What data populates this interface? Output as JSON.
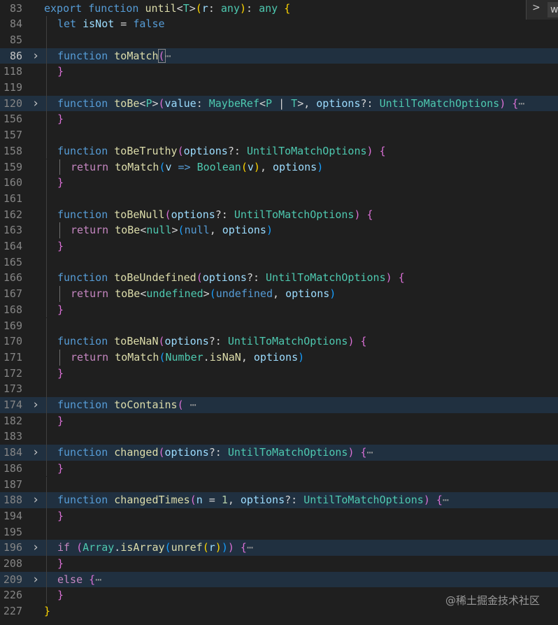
{
  "editor": {
    "lines": [
      {
        "n": "83",
        "tokens": [
          [
            "kw",
            "export "
          ],
          [
            "kw",
            "function "
          ],
          [
            "fn",
            "until"
          ],
          [
            "pl",
            "<"
          ],
          [
            "type",
            "T"
          ],
          [
            "pl",
            ">"
          ],
          [
            "br1",
            "("
          ],
          [
            "var",
            "r"
          ],
          [
            "pl",
            ": "
          ],
          [
            "type",
            "any"
          ],
          [
            "br1",
            ")"
          ],
          [
            "pl",
            ": "
          ],
          [
            "type",
            "any"
          ],
          [
            "pl",
            " "
          ],
          [
            "br1",
            "{"
          ]
        ]
      },
      {
        "n": "84",
        "tokens": [
          [
            "kw",
            "let "
          ],
          [
            "var",
            "isNot"
          ],
          [
            "pl",
            " = "
          ],
          [
            "kw",
            "false"
          ]
        ]
      },
      {
        "n": "85",
        "tokens": []
      },
      {
        "n": "86",
        "active": true,
        "fold": true,
        "tokens": [
          [
            "kw",
            "function "
          ],
          [
            "fn",
            "toMatch"
          ],
          [
            "br2",
            "("
          ],
          [
            "dim",
            "⋯"
          ]
        ]
      },
      {
        "n": "118",
        "tokens": [
          [
            "br2",
            "}"
          ]
        ]
      },
      {
        "n": "119",
        "tokens": []
      },
      {
        "n": "120",
        "fold": true,
        "tokens": [
          [
            "kw",
            "function "
          ],
          [
            "fn",
            "toBe"
          ],
          [
            "pl",
            "<"
          ],
          [
            "type",
            "P"
          ],
          [
            "pl",
            ">"
          ],
          [
            "br2",
            "("
          ],
          [
            "var",
            "value"
          ],
          [
            "pl",
            ": "
          ],
          [
            "type",
            "MaybeRef"
          ],
          [
            "pl",
            "<"
          ],
          [
            "type",
            "P"
          ],
          [
            "pl",
            " | "
          ],
          [
            "type",
            "T"
          ],
          [
            "pl",
            ">"
          ],
          [
            "pl",
            ", "
          ],
          [
            "var",
            "options"
          ],
          [
            "pl",
            "?: "
          ],
          [
            "type",
            "UntilToMatchOptions"
          ],
          [
            "br2",
            ")"
          ],
          [
            "pl",
            " "
          ],
          [
            "br2",
            "{"
          ],
          [
            "dim",
            "⋯"
          ]
        ]
      },
      {
        "n": "156",
        "tokens": [
          [
            "br2",
            "}"
          ]
        ]
      },
      {
        "n": "157",
        "tokens": []
      },
      {
        "n": "158",
        "tokens": [
          [
            "kw",
            "function "
          ],
          [
            "fn",
            "toBeTruthy"
          ],
          [
            "br2",
            "("
          ],
          [
            "var",
            "options"
          ],
          [
            "pl",
            "?: "
          ],
          [
            "type",
            "UntilToMatchOptions"
          ],
          [
            "br2",
            ")"
          ],
          [
            "pl",
            " "
          ],
          [
            "br2",
            "{"
          ]
        ]
      },
      {
        "n": "159",
        "tokens": [
          [
            "ctl",
            "return "
          ],
          [
            "fn",
            "toMatch"
          ],
          [
            "br3",
            "("
          ],
          [
            "var",
            "v"
          ],
          [
            "pl",
            " "
          ],
          [
            "kw",
            "=>"
          ],
          [
            "pl",
            " "
          ],
          [
            "type",
            "Boolean"
          ],
          [
            "br1",
            "("
          ],
          [
            "var",
            "v"
          ],
          [
            "br1",
            ")"
          ],
          [
            "pl",
            ", "
          ],
          [
            "var",
            "options"
          ],
          [
            "br3",
            ")"
          ]
        ]
      },
      {
        "n": "160",
        "tokens": [
          [
            "br2",
            "}"
          ]
        ]
      },
      {
        "n": "161",
        "tokens": []
      },
      {
        "n": "162",
        "tokens": [
          [
            "kw",
            "function "
          ],
          [
            "fn",
            "toBeNull"
          ],
          [
            "br2",
            "("
          ],
          [
            "var",
            "options"
          ],
          [
            "pl",
            "?: "
          ],
          [
            "type",
            "UntilToMatchOptions"
          ],
          [
            "br2",
            ")"
          ],
          [
            "pl",
            " "
          ],
          [
            "br2",
            "{"
          ]
        ]
      },
      {
        "n": "163",
        "tokens": [
          [
            "ctl",
            "return "
          ],
          [
            "fn",
            "toBe"
          ],
          [
            "pl",
            "<"
          ],
          [
            "type",
            "null"
          ],
          [
            "pl",
            ">"
          ],
          [
            "br3",
            "("
          ],
          [
            "kw",
            "null"
          ],
          [
            "pl",
            ", "
          ],
          [
            "var",
            "options"
          ],
          [
            "br3",
            ")"
          ]
        ]
      },
      {
        "n": "164",
        "tokens": [
          [
            "br2",
            "}"
          ]
        ]
      },
      {
        "n": "165",
        "tokens": []
      },
      {
        "n": "166",
        "tokens": [
          [
            "kw",
            "function "
          ],
          [
            "fn",
            "toBeUndefined"
          ],
          [
            "br2",
            "("
          ],
          [
            "var",
            "options"
          ],
          [
            "pl",
            "?: "
          ],
          [
            "type",
            "UntilToMatchOptions"
          ],
          [
            "br2",
            ")"
          ],
          [
            "pl",
            " "
          ],
          [
            "br2",
            "{"
          ]
        ]
      },
      {
        "n": "167",
        "tokens": [
          [
            "ctl",
            "return "
          ],
          [
            "fn",
            "toBe"
          ],
          [
            "pl",
            "<"
          ],
          [
            "type",
            "undefined"
          ],
          [
            "pl",
            ">"
          ],
          [
            "br3",
            "("
          ],
          [
            "kw",
            "undefined"
          ],
          [
            "pl",
            ", "
          ],
          [
            "var",
            "options"
          ],
          [
            "br3",
            ")"
          ]
        ]
      },
      {
        "n": "168",
        "tokens": [
          [
            "br2",
            "}"
          ]
        ]
      },
      {
        "n": "169",
        "tokens": []
      },
      {
        "n": "170",
        "tokens": [
          [
            "kw",
            "function "
          ],
          [
            "fn",
            "toBeNaN"
          ],
          [
            "br2",
            "("
          ],
          [
            "var",
            "options"
          ],
          [
            "pl",
            "?: "
          ],
          [
            "type",
            "UntilToMatchOptions"
          ],
          [
            "br2",
            ")"
          ],
          [
            "pl",
            " "
          ],
          [
            "br2",
            "{"
          ]
        ]
      },
      {
        "n": "171",
        "tokens": [
          [
            "ctl",
            "return "
          ],
          [
            "fn",
            "toMatch"
          ],
          [
            "br3",
            "("
          ],
          [
            "type",
            "Number"
          ],
          [
            "pl",
            "."
          ],
          [
            "fn",
            "isNaN"
          ],
          [
            "pl",
            ", "
          ],
          [
            "var",
            "options"
          ],
          [
            "br3",
            ")"
          ]
        ]
      },
      {
        "n": "172",
        "tokens": [
          [
            "br2",
            "}"
          ]
        ]
      },
      {
        "n": "173",
        "tokens": []
      },
      {
        "n": "174",
        "fold": true,
        "tokens": [
          [
            "kw",
            "function "
          ],
          [
            "fn",
            "toContains"
          ],
          [
            "br2",
            "("
          ],
          [
            "pl",
            " "
          ],
          [
            "dim",
            "⋯"
          ]
        ]
      },
      {
        "n": "182",
        "tokens": [
          [
            "br2",
            "}"
          ]
        ]
      },
      {
        "n": "183",
        "tokens": []
      },
      {
        "n": "184",
        "fold": true,
        "tokens": [
          [
            "kw",
            "function "
          ],
          [
            "fn",
            "changed"
          ],
          [
            "br2",
            "("
          ],
          [
            "var",
            "options"
          ],
          [
            "pl",
            "?: "
          ],
          [
            "type",
            "UntilToMatchOptions"
          ],
          [
            "br2",
            ")"
          ],
          [
            "pl",
            " "
          ],
          [
            "br2",
            "{"
          ],
          [
            "dim",
            "⋯"
          ]
        ]
      },
      {
        "n": "186",
        "tokens": [
          [
            "br2",
            "}"
          ]
        ]
      },
      {
        "n": "187",
        "tokens": []
      },
      {
        "n": "188",
        "fold": true,
        "tokens": [
          [
            "kw",
            "function "
          ],
          [
            "fn",
            "changedTimes"
          ],
          [
            "br2",
            "("
          ],
          [
            "var",
            "n"
          ],
          [
            "pl",
            " = "
          ],
          [
            "num",
            "1"
          ],
          [
            "pl",
            ", "
          ],
          [
            "var",
            "options"
          ],
          [
            "pl",
            "?: "
          ],
          [
            "type",
            "UntilToMatchOptions"
          ],
          [
            "br2",
            ")"
          ],
          [
            "pl",
            " "
          ],
          [
            "br2",
            "{"
          ],
          [
            "dim",
            "⋯"
          ]
        ]
      },
      {
        "n": "194",
        "tokens": [
          [
            "br2",
            "}"
          ]
        ]
      },
      {
        "n": "195",
        "tokens": []
      },
      {
        "n": "196",
        "fold": true,
        "tokens": [
          [
            "ctl",
            "if "
          ],
          [
            "br2",
            "("
          ],
          [
            "type",
            "Array"
          ],
          [
            "pl",
            "."
          ],
          [
            "fn",
            "isArray"
          ],
          [
            "br3",
            "("
          ],
          [
            "fn",
            "unref"
          ],
          [
            "br1",
            "("
          ],
          [
            "var",
            "r"
          ],
          [
            "br1",
            ")"
          ],
          [
            "br3",
            ")"
          ],
          [
            "br2",
            ")"
          ],
          [
            "pl",
            " "
          ],
          [
            "br2",
            "{"
          ],
          [
            "dim",
            "⋯"
          ]
        ]
      },
      {
        "n": "208",
        "tokens": [
          [
            "br2",
            "}"
          ]
        ]
      },
      {
        "n": "209",
        "fold": true,
        "tokens": [
          [
            "ctl",
            "else "
          ],
          [
            "br2",
            "{"
          ],
          [
            "dim",
            "⋯"
          ]
        ]
      },
      {
        "n": "226",
        "tokens": [
          [
            "br2",
            "}"
          ]
        ]
      },
      {
        "n": "227",
        "tokens": [
          [
            "br1",
            "}"
          ]
        ]
      }
    ]
  },
  "suggest": {
    "chevron": ">",
    "text": "wa"
  },
  "watermark": "@稀土掘金技术社区",
  "icons": {
    "fold": "chevron-right-icon"
  }
}
